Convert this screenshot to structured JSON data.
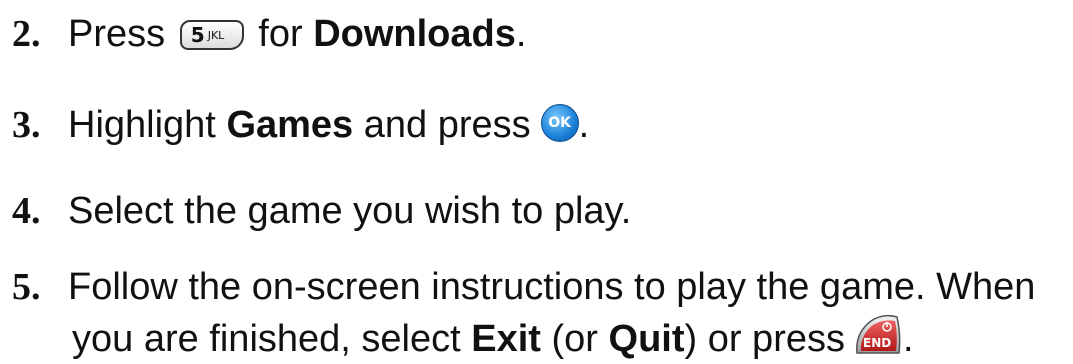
{
  "steps": [
    {
      "number": "2.",
      "prefix": "Press",
      "key_icon": "key-5-jkl-icon",
      "key_label": "5",
      "key_sub": "JKL",
      "middle": "for",
      "bold": "Downloads",
      "suffix": "."
    },
    {
      "number": "3.",
      "prefix": "Highlight",
      "bold": "Games",
      "middle": "and press",
      "key_icon": "ok-key-icon",
      "key_label": "OK",
      "suffix": "."
    },
    {
      "number": "4.",
      "text": "Select the game you wish to play."
    },
    {
      "number": "5.",
      "line1": "Follow the on-screen instructions to play the game. When",
      "line2_prefix": "you are finished, select",
      "bold1": "Exit",
      "mid": "(or",
      "bold2": "Quit",
      "mid2": ") or press",
      "key_icon": "end-key-icon",
      "key_label": "END",
      "suffix": "."
    }
  ],
  "colors": {
    "text": "#111111",
    "ok_key": "#1a7fd6",
    "end_key": "#d42a2a"
  }
}
